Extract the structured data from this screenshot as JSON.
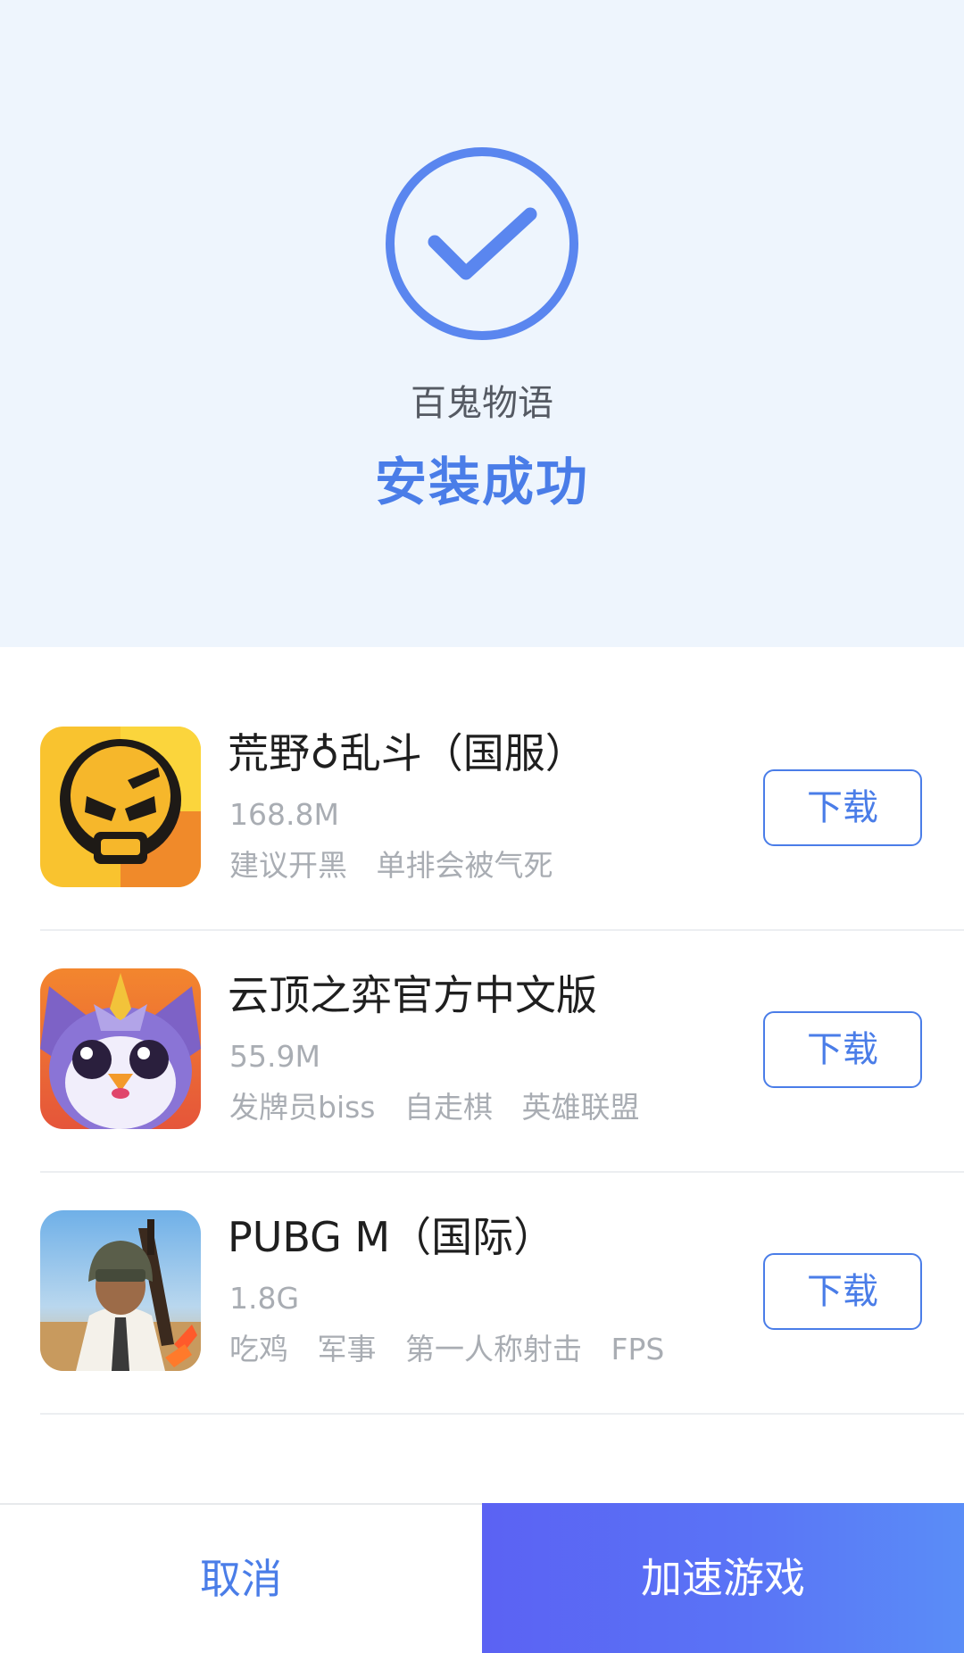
{
  "hero": {
    "game_name": "百鬼物语",
    "status": "安装成功",
    "icon": "check-circle-icon",
    "accent_color": "#4a7de8",
    "background_color": "#eef5fd"
  },
  "apps": [
    {
      "title": "荒野♁乱斗（国服）",
      "size": "168.8M",
      "tags": [
        "建议开黑",
        "单排会被气死"
      ],
      "icon": "brawl-stars-icon",
      "button": "下载"
    },
    {
      "title": "云顶之弈官方中文版",
      "size": "55.9M",
      "tags": [
        "发牌员biss",
        "自走棋",
        "英雄联盟"
      ],
      "icon": "tft-penguin-icon",
      "button": "下载"
    },
    {
      "title": "PUBG M（国际）",
      "size": "1.8G",
      "tags": [
        "吃鸡",
        "军事",
        "第一人称射击",
        "FPS"
      ],
      "icon": "pubg-soldier-icon",
      "button": "下载"
    }
  ],
  "footer": {
    "cancel": "取消",
    "accelerate": "加速游戏"
  }
}
